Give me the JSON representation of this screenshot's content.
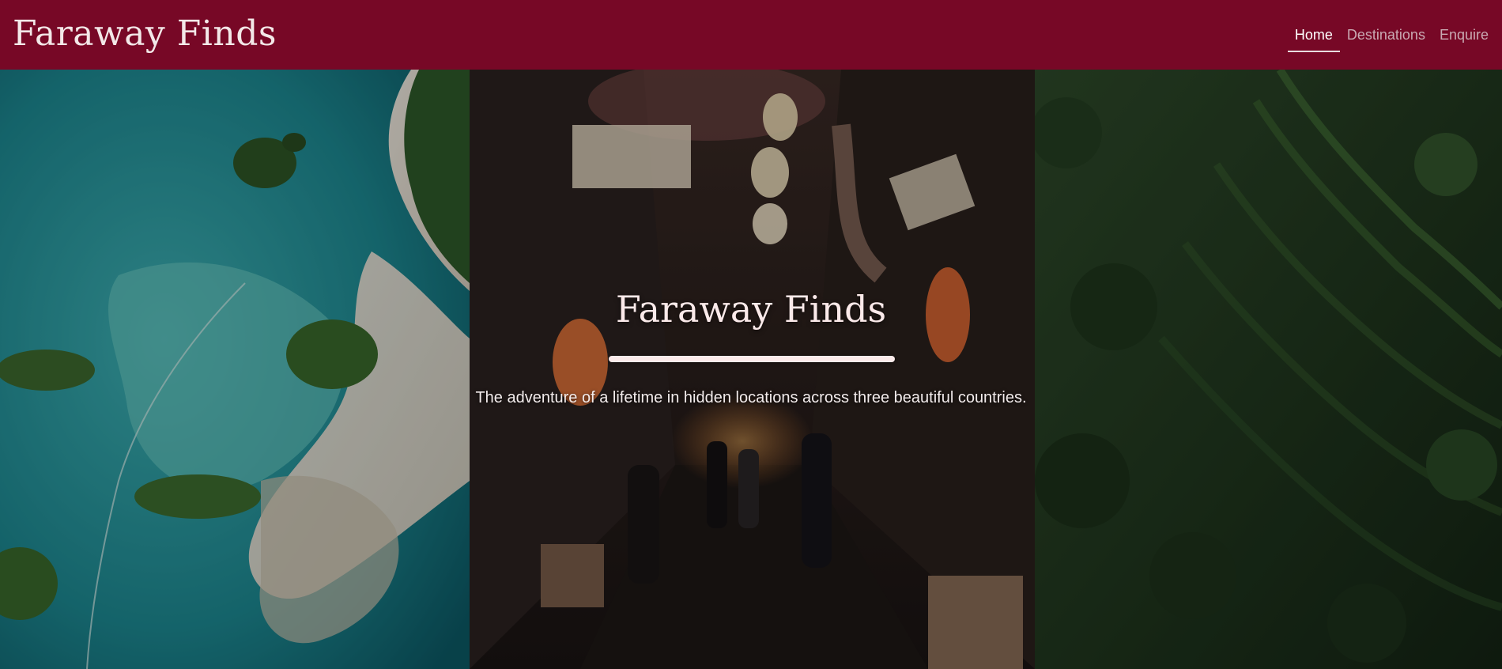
{
  "header": {
    "brand": "Faraway Finds",
    "nav": [
      {
        "label": "Home",
        "active": true
      },
      {
        "label": "Destinations",
        "active": false
      },
      {
        "label": "Enquire",
        "active": false
      }
    ]
  },
  "hero": {
    "title": "Faraway Finds",
    "subtitle": "The adventure of a lifetime in hidden locations across three beautiful countries.",
    "panels": [
      {
        "image": "aerial-tropical-islands-photo"
      },
      {
        "image": "night-alley-lanterns-photo"
      },
      {
        "image": "jungle-rice-terraces-photo"
      }
    ]
  },
  "colors": {
    "header_bg": "#770826",
    "nav_active": "#ffffff",
    "nav_inactive": "#c9a9b2",
    "hero_text": "#fbeaea"
  }
}
